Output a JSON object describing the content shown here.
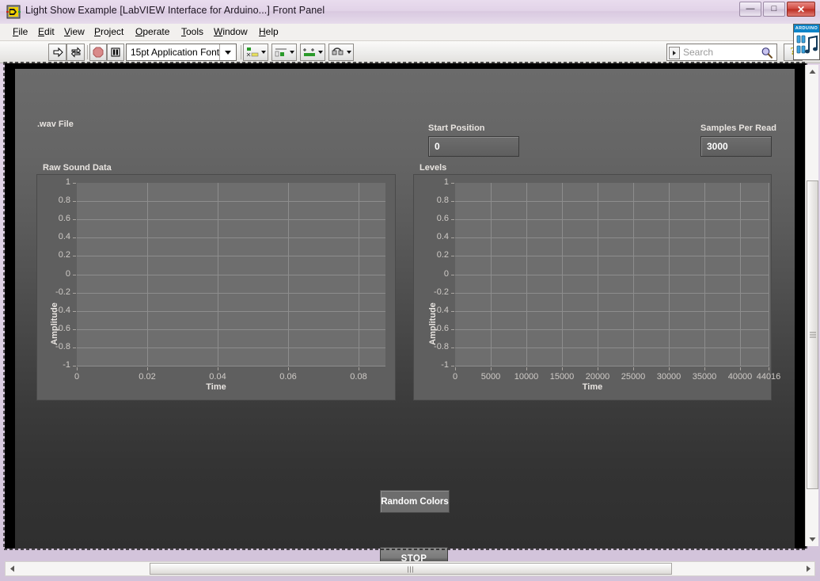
{
  "window": {
    "title": "Light Show Example [LabVIEW Interface for Arduino...] Front Panel",
    "vi_icon": "labview-vi-icon",
    "minimize_label": "—",
    "maximize_label": "□",
    "close_label": "✕"
  },
  "menu": {
    "items": [
      {
        "label": "File",
        "accel": "F"
      },
      {
        "label": "Edit",
        "accel": "E"
      },
      {
        "label": "View",
        "accel": "V"
      },
      {
        "label": "Project",
        "accel": "P"
      },
      {
        "label": "Operate",
        "accel": "O"
      },
      {
        "label": "Tools",
        "accel": "T"
      },
      {
        "label": "Window",
        "accel": "W"
      },
      {
        "label": "Help",
        "accel": "H"
      }
    ]
  },
  "toolbar": {
    "run_icon": "run-arrow-icon",
    "run_continuous_icon": "run-continuously-icon",
    "abort_icon": "abort-execution-icon",
    "pause_icon": "pause-icon",
    "font_selector_value": "15pt Application Font",
    "align_icon": "align-objects-icon",
    "distribute_icon": "distribute-objects-icon",
    "resize_icon": "resize-objects-icon",
    "reorder_icon": "reorder-objects-icon",
    "search_placeholder": "Search",
    "search_value": "",
    "search_icon": "magnifier-icon",
    "search_dropdown_icon": "dropdown-arrow-icon",
    "help_label": "?",
    "badge_title": "ARDUINO",
    "badge_icon": "arduino-music-icon"
  },
  "panel": {
    "wav_file": {
      "label": ".wav File",
      "value": "",
      "path_icon": "path-browse-icon",
      "browse_icon": "folder-open-icon"
    },
    "start_position": {
      "label": "Start Position",
      "value": "0"
    },
    "samples_per_read": {
      "label": "Samples Per Read",
      "value": "3000"
    },
    "random_colors_label": "Random Colors",
    "stop_label": "STOP"
  },
  "chart_data": [
    {
      "type": "line",
      "title": "Raw Sound Data",
      "xlabel": "Time",
      "ylabel": "Amplitude",
      "xlim": [
        0,
        0.0875
      ],
      "ylim": [
        -1,
        1
      ],
      "xticks": [
        0,
        0.02,
        0.04,
        0.06,
        0.08
      ],
      "xtick_labels": [
        "0",
        "0.02",
        "0.04",
        "0.06",
        "0.08"
      ],
      "yticks": [
        1,
        0.8,
        0.6,
        0.4,
        0.2,
        0,
        -0.2,
        -0.4,
        -0.6,
        -0.8,
        -1
      ],
      "ytick_labels": [
        "1",
        "0.8",
        "0.6",
        "0.4",
        "0.2",
        "0",
        "-0.2",
        "-0.4",
        "-0.6",
        "-0.8",
        "-1"
      ],
      "grid": true,
      "legend": false,
      "series": [
        {
          "name": "Raw Sound Data",
          "x": [],
          "y": []
        }
      ]
    },
    {
      "type": "line",
      "title": "Levels",
      "xlabel": "Time",
      "ylabel": "Amplitude",
      "xlim": [
        0,
        44016
      ],
      "ylim": [
        -1,
        1
      ],
      "xticks": [
        0,
        5000,
        10000,
        15000,
        20000,
        25000,
        30000,
        35000,
        40000,
        44016
      ],
      "xtick_labels": [
        "0",
        "5000",
        "10000",
        "15000",
        "20000",
        "25000",
        "30000",
        "35000",
        "40000",
        "44016"
      ],
      "yticks": [
        1,
        0.8,
        0.6,
        0.4,
        0.2,
        0,
        -0.2,
        -0.4,
        -0.6,
        -0.8,
        -1
      ],
      "ytick_labels": [
        "1",
        "0.8",
        "0.6",
        "0.4",
        "0.2",
        "0",
        "-0.2",
        "-0.4",
        "-0.6",
        "-0.8",
        "-1"
      ],
      "grid": true,
      "legend": false,
      "series": [
        {
          "name": "Levels",
          "x": [],
          "y": []
        }
      ]
    }
  ],
  "scrollbars": {
    "vertical_up_icon": "scroll-up-icon",
    "vertical_down_icon": "scroll-down-icon",
    "horizontal_left_icon": "scroll-left-icon",
    "horizontal_right_icon": "scroll-right-icon"
  },
  "colors": {
    "title_bar": "#e2d3e8",
    "panel_top": "#6b6b6b",
    "panel_bottom": "#2f2f2f",
    "plot_bg": "#6e6e6e",
    "gridline": "#8d8d8d",
    "label_text": "#e8e4e0",
    "tick_text": "#cfcbc7",
    "close_button": "#cf4a42",
    "arduino_blue": "#0d84c8"
  }
}
